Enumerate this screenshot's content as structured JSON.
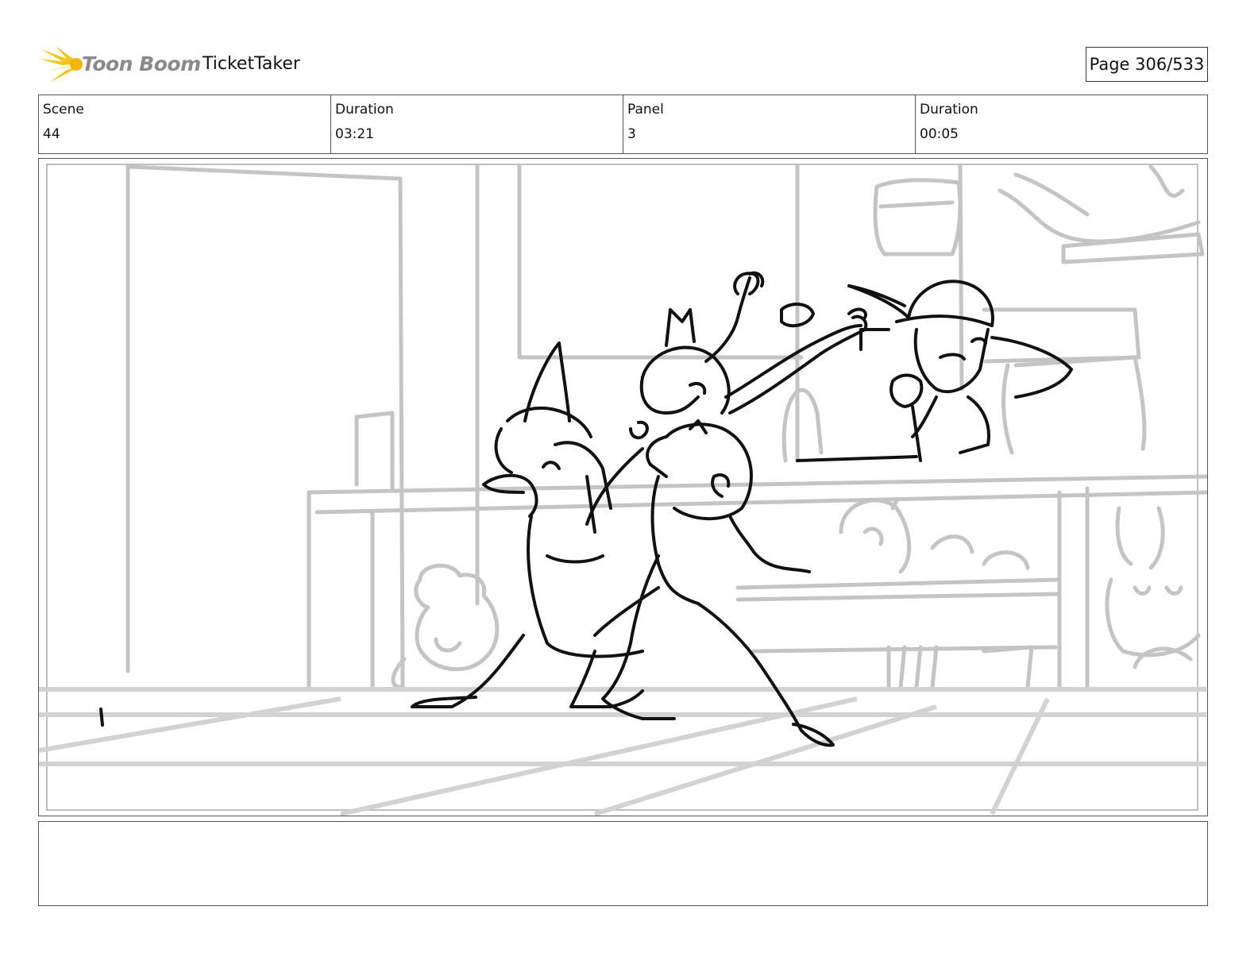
{
  "header": {
    "brand": "Toon Boom",
    "project": "TicketTaker",
    "page": "Page 306/533"
  },
  "info": [
    {
      "label": "Scene",
      "value": "44"
    },
    {
      "label": "Duration",
      "value": "03:21"
    },
    {
      "label": "Panel",
      "value": "3"
    },
    {
      "label": "Duration",
      "value": "00:05"
    }
  ],
  "notes": "",
  "colors": {
    "logo_yellow": "#f5c518",
    "logo_text": "#8a8a8a",
    "sketch_bg": "#c4c4c4",
    "sketch_fg": "#111111"
  }
}
